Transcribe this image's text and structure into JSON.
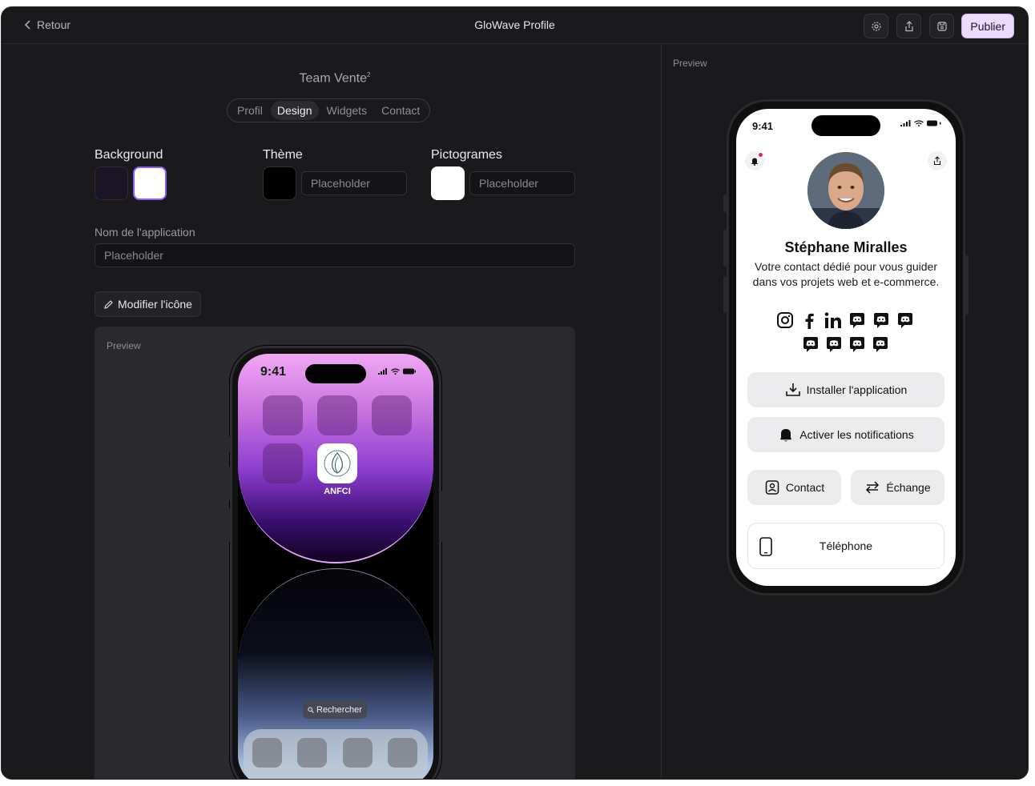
{
  "header": {
    "back_label": "Retour",
    "app_title": "GloWave Profile",
    "publish_label": "Publier",
    "icons": [
      "gear-icon",
      "share-icon",
      "save-icon"
    ]
  },
  "editor": {
    "team_name": "Team Vente",
    "team_sup": "2",
    "tabs": [
      "Profil",
      "Design",
      "Widgets",
      "Contact"
    ],
    "active_tab": "Design",
    "background_label": "Background",
    "theme_label": "Thème",
    "theme_placeholder": "Placeholder",
    "pictograms_label": "Pictogrames",
    "pictograms_placeholder": "Placeholder",
    "app_name_label": "Nom de l'application",
    "app_name_placeholder": "Placeholder",
    "modify_icon_label": "Modifier l'icône",
    "preview_label": "Preview",
    "colors": {
      "bg_dark": "#1a1424",
      "bg_white": "#ffffff",
      "theme": "#000000",
      "pictograms": "#ffffff",
      "selected_border": "#8b5cf6"
    }
  },
  "phone_home": {
    "time": "9:41",
    "app_name": "ANFCI",
    "search_label": "Rechercher"
  },
  "profile_preview": {
    "preview_label": "Preview",
    "time": "9:41",
    "name": "Stéphane Miralles",
    "bio": "Votre contact dédié pour vous guider dans vos projets web et e-commerce.",
    "social_icons_row1": [
      "instagram-icon",
      "facebook-icon",
      "linkedin-icon",
      "discord-icon",
      "discord-icon",
      "discord-icon"
    ],
    "social_icons_row2": [
      "discord-icon",
      "discord-icon",
      "discord-icon",
      "discord-icon"
    ],
    "install_label": "Installer l'application",
    "notifications_label": "Activer les notifications",
    "contact_label": "Contact",
    "exchange_label": "Échange",
    "phone_label": "Téléphone"
  }
}
